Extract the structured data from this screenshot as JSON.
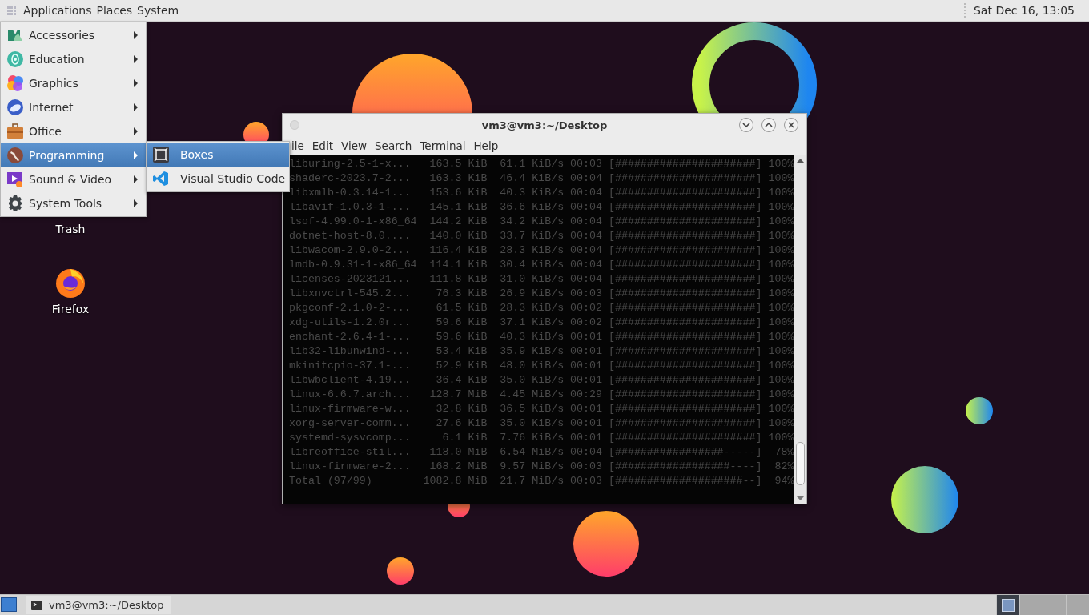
{
  "top_panel": {
    "menus": [
      "Applications",
      "Places",
      "System"
    ],
    "clock": "Sat Dec 16, 13:05"
  },
  "app_menu": {
    "items": [
      {
        "label": "Accessories",
        "selected": false
      },
      {
        "label": "Education",
        "selected": false
      },
      {
        "label": "Graphics",
        "selected": false
      },
      {
        "label": "Internet",
        "selected": false
      },
      {
        "label": "Office",
        "selected": false
      },
      {
        "label": "Programming",
        "selected": true
      },
      {
        "label": "Sound & Video",
        "selected": false
      },
      {
        "label": "System Tools",
        "selected": false
      }
    ]
  },
  "submenu": {
    "items": [
      {
        "label": "Boxes",
        "selected": true
      },
      {
        "label": "Visual Studio Code",
        "selected": false
      }
    ]
  },
  "desktop_icons": [
    {
      "label": "Trash"
    },
    {
      "label": "Firefox"
    }
  ],
  "terminal": {
    "title": "vm3@vm3:~/Desktop",
    "menus": [
      "ile",
      "Edit",
      "View",
      "Search",
      "Terminal",
      "Help"
    ],
    "lines": [
      "liburing-2.5-1-x...   163.5 KiB  61.1 KiB/s 00:03 [######################] 100%",
      "shaderc-2023.7-2...   163.3 KiB  46.4 KiB/s 00:04 [######################] 100%",
      "libxmlb-0.3.14-1...   153.6 KiB  40.3 KiB/s 00:04 [######################] 100%",
      "libavif-1.0.3-1-...   145.1 KiB  36.6 KiB/s 00:04 [######################] 100%",
      "lsof-4.99.0-1-x86_64  144.2 KiB  34.2 KiB/s 00:04 [######################] 100%",
      "dotnet-host-8.0....   140.0 KiB  33.7 KiB/s 00:04 [######################] 100%",
      "libwacom-2.9.0-2...   116.4 KiB  28.3 KiB/s 00:04 [######################] 100%",
      "lmdb-0.9.31-1-x86_64  114.1 KiB  30.4 KiB/s 00:04 [######################] 100%",
      "licenses-2023121...   111.8 KiB  31.0 KiB/s 00:04 [######################] 100%",
      "libxnvctrl-545.2...    76.3 KiB  26.9 KiB/s 00:03 [######################] 100%",
      "pkgconf-2.1.0-2-...    61.5 KiB  28.3 KiB/s 00:02 [######################] 100%",
      "xdg-utils-1.2.0r...    59.6 KiB  37.1 KiB/s 00:02 [######################] 100%",
      "enchant-2.6.4-1-...    59.6 KiB  40.3 KiB/s 00:01 [######################] 100%",
      "lib32-libunwind-...    53.4 KiB  35.9 KiB/s 00:01 [######################] 100%",
      "mkinitcpio-37.1-...    52.9 KiB  48.0 KiB/s 00:01 [######################] 100%",
      "libwbclient-4.19...    36.4 KiB  35.0 KiB/s 00:01 [######################] 100%",
      "linux-6.6.7.arch...   128.7 MiB  4.45 MiB/s 00:29 [######################] 100%",
      "linux-firmware-w...    32.8 KiB  36.5 KiB/s 00:01 [######################] 100%",
      "xorg-server-comm...    27.6 KiB  35.0 KiB/s 00:01 [######################] 100%",
      "systemd-sysvcomp...     6.1 KiB  7.76 KiB/s 00:01 [######################] 100%",
      "libreoffice-stil...   118.0 MiB  6.54 MiB/s 00:04 [#################-----]  78%",
      "linux-firmware-2...   168.2 MiB  9.57 MiB/s 00:03 [##################----]  82%",
      "Total (97/99)        1082.8 MiB  21.7 MiB/s 00:03 [####################--]  94%"
    ]
  },
  "taskbar": {
    "tasks": [
      {
        "label": "vm3@vm3:~/Desktop"
      }
    ],
    "workspaces": [
      {
        "selected": true
      },
      {
        "selected": false
      },
      {
        "selected": false
      },
      {
        "selected": false
      }
    ]
  }
}
